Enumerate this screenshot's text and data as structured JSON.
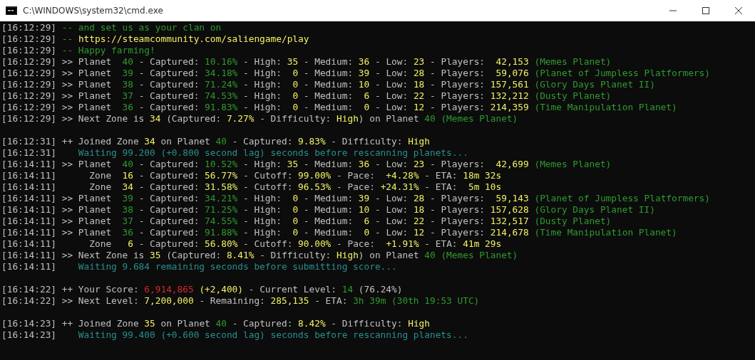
{
  "window": {
    "title": "C:\\WINDOWS\\system32\\cmd.exe"
  },
  "lines": [
    {
      "kind": "log",
      "time": "[16:12:29]",
      "segments": [
        {
          "text": " -- and set us as your clan on",
          "color": "#2f9a2f"
        }
      ]
    },
    {
      "kind": "log",
      "time": "[16:12:29]",
      "segments": [
        {
          "text": " -- ",
          "color": "#2f9a2f"
        },
        {
          "text": "https://steamcommunity.com/saliengame/play",
          "color": "#f2f266"
        }
      ]
    },
    {
      "kind": "log",
      "time": "[16:12:29]",
      "segments": [
        {
          "text": " -- Happy farming!",
          "color": "#2f9a2f"
        }
      ]
    },
    {
      "kind": "log",
      "time": "[16:12:29]",
      "segments": [
        {
          "text": " >> Planet  ",
          "color": "#c0c0c0"
        },
        {
          "text": "40",
          "color": "#2f9a2f"
        },
        {
          "text": " - Captured: ",
          "color": "#c0c0c0"
        },
        {
          "text": "10.16%",
          "color": "#2f9a2f"
        },
        {
          "text": " - High: ",
          "color": "#c0c0c0"
        },
        {
          "text": "35",
          "color": "#f2f266"
        },
        {
          "text": " - Medium: ",
          "color": "#c0c0c0"
        },
        {
          "text": "36",
          "color": "#f2f266"
        },
        {
          "text": " - Low: ",
          "color": "#c0c0c0"
        },
        {
          "text": "23",
          "color": "#f2f266"
        },
        {
          "text": " - Players:  ",
          "color": "#c0c0c0"
        },
        {
          "text": "42,153",
          "color": "#f2f266"
        },
        {
          "text": " (Memes Planet)",
          "color": "#2f9a2f"
        }
      ]
    },
    {
      "kind": "log",
      "time": "[16:12:29]",
      "segments": [
        {
          "text": " >> Planet  ",
          "color": "#c0c0c0"
        },
        {
          "text": "39",
          "color": "#2f9a2f"
        },
        {
          "text": " - Captured: ",
          "color": "#c0c0c0"
        },
        {
          "text": "34.18%",
          "color": "#2f9a2f"
        },
        {
          "text": " - High:  ",
          "color": "#c0c0c0"
        },
        {
          "text": "0",
          "color": "#f2f266"
        },
        {
          "text": " - Medium: ",
          "color": "#c0c0c0"
        },
        {
          "text": "39",
          "color": "#f2f266"
        },
        {
          "text": " - Low: ",
          "color": "#c0c0c0"
        },
        {
          "text": "28",
          "color": "#f2f266"
        },
        {
          "text": " - Players:  ",
          "color": "#c0c0c0"
        },
        {
          "text": "59,076",
          "color": "#f2f266"
        },
        {
          "text": " (Planet of Jumpless Platformers)",
          "color": "#2f9a2f"
        }
      ]
    },
    {
      "kind": "log",
      "time": "[16:12:29]",
      "segments": [
        {
          "text": " >> Planet  ",
          "color": "#c0c0c0"
        },
        {
          "text": "38",
          "color": "#2f9a2f"
        },
        {
          "text": " - Captured: ",
          "color": "#c0c0c0"
        },
        {
          "text": "71.24%",
          "color": "#2f9a2f"
        },
        {
          "text": " - High:  ",
          "color": "#c0c0c0"
        },
        {
          "text": "0",
          "color": "#f2f266"
        },
        {
          "text": " - Medium: ",
          "color": "#c0c0c0"
        },
        {
          "text": "10",
          "color": "#f2f266"
        },
        {
          "text": " - Low: ",
          "color": "#c0c0c0"
        },
        {
          "text": "18",
          "color": "#f2f266"
        },
        {
          "text": " - Players: ",
          "color": "#c0c0c0"
        },
        {
          "text": "157,561",
          "color": "#f2f266"
        },
        {
          "text": " (Glory Days Planet II)",
          "color": "#2f9a2f"
        }
      ]
    },
    {
      "kind": "log",
      "time": "[16:12:29]",
      "segments": [
        {
          "text": " >> Planet  ",
          "color": "#c0c0c0"
        },
        {
          "text": "37",
          "color": "#2f9a2f"
        },
        {
          "text": " - Captured: ",
          "color": "#c0c0c0"
        },
        {
          "text": "74.53%",
          "color": "#2f9a2f"
        },
        {
          "text": " - High:  ",
          "color": "#c0c0c0"
        },
        {
          "text": "0",
          "color": "#f2f266"
        },
        {
          "text": " - Medium:  ",
          "color": "#c0c0c0"
        },
        {
          "text": "6",
          "color": "#f2f266"
        },
        {
          "text": " - Low: ",
          "color": "#c0c0c0"
        },
        {
          "text": "22",
          "color": "#f2f266"
        },
        {
          "text": " - Players: ",
          "color": "#c0c0c0"
        },
        {
          "text": "132,212",
          "color": "#f2f266"
        },
        {
          "text": " (Dusty Planet)",
          "color": "#2f9a2f"
        }
      ]
    },
    {
      "kind": "log",
      "time": "[16:12:29]",
      "segments": [
        {
          "text": " >> Planet  ",
          "color": "#c0c0c0"
        },
        {
          "text": "36",
          "color": "#2f9a2f"
        },
        {
          "text": " - Captured: ",
          "color": "#c0c0c0"
        },
        {
          "text": "91.83%",
          "color": "#2f9a2f"
        },
        {
          "text": " - High:  ",
          "color": "#c0c0c0"
        },
        {
          "text": "0",
          "color": "#f2f266"
        },
        {
          "text": " - Medium:  ",
          "color": "#c0c0c0"
        },
        {
          "text": "0",
          "color": "#f2f266"
        },
        {
          "text": " - Low: ",
          "color": "#c0c0c0"
        },
        {
          "text": "12",
          "color": "#f2f266"
        },
        {
          "text": " - Players: ",
          "color": "#c0c0c0"
        },
        {
          "text": "214,359",
          "color": "#f2f266"
        },
        {
          "text": " (Time Manipulation Planet)",
          "color": "#2f9a2f"
        }
      ]
    },
    {
      "kind": "log",
      "time": "[16:12:29]",
      "segments": [
        {
          "text": " >> Next Zone is ",
          "color": "#c0c0c0"
        },
        {
          "text": "34",
          "color": "#f2f266"
        },
        {
          "text": " (Captured: ",
          "color": "#c0c0c0"
        },
        {
          "text": "7.27%",
          "color": "#f2f266"
        },
        {
          "text": " - Difficulty: ",
          "color": "#c0c0c0"
        },
        {
          "text": "High",
          "color": "#f2f266"
        },
        {
          "text": ") on Planet ",
          "color": "#c0c0c0"
        },
        {
          "text": "40 (Memes Planet)",
          "color": "#2f9a2f"
        }
      ]
    },
    {
      "kind": "blank"
    },
    {
      "kind": "log",
      "time": "[16:12:31]",
      "segments": [
        {
          "text": " ++ Joined Zone ",
          "color": "#c0c0c0"
        },
        {
          "text": "34",
          "color": "#f2f266"
        },
        {
          "text": " on Planet ",
          "color": "#c0c0c0"
        },
        {
          "text": "40",
          "color": "#2f9a2f"
        },
        {
          "text": " - Captured: ",
          "color": "#c0c0c0"
        },
        {
          "text": "9.83%",
          "color": "#f2f266"
        },
        {
          "text": " - Difficulty: ",
          "color": "#c0c0c0"
        },
        {
          "text": "High",
          "color": "#f2f266"
        }
      ]
    },
    {
      "kind": "log",
      "time": "[16:12:31]",
      "segments": [
        {
          "text": "    Waiting 99.200 (+0.800 second lag) seconds before rescanning planets...",
          "color": "#2a8e8e"
        }
      ]
    },
    {
      "kind": "log",
      "time": "[16:14:11]",
      "segments": [
        {
          "text": " >> Planet  ",
          "color": "#c0c0c0"
        },
        {
          "text": "40",
          "color": "#2f9a2f"
        },
        {
          "text": " - Captured: ",
          "color": "#c0c0c0"
        },
        {
          "text": "10.52%",
          "color": "#2f9a2f"
        },
        {
          "text": " - High: ",
          "color": "#c0c0c0"
        },
        {
          "text": "35",
          "color": "#f2f266"
        },
        {
          "text": " - Medium: ",
          "color": "#c0c0c0"
        },
        {
          "text": "36",
          "color": "#f2f266"
        },
        {
          "text": " - Low: ",
          "color": "#c0c0c0"
        },
        {
          "text": "23",
          "color": "#f2f266"
        },
        {
          "text": " - Players:  ",
          "color": "#c0c0c0"
        },
        {
          "text": "42,699",
          "color": "#f2f266"
        },
        {
          "text": " (Memes Planet)",
          "color": "#2f9a2f"
        }
      ]
    },
    {
      "kind": "log",
      "time": "[16:14:11]",
      "segments": [
        {
          "text": "      Zone  ",
          "color": "#c0c0c0"
        },
        {
          "text": "16",
          "color": "#f2f266"
        },
        {
          "text": " - Captured: ",
          "color": "#c0c0c0"
        },
        {
          "text": "56.77%",
          "color": "#f2f266"
        },
        {
          "text": " - Cutoff: ",
          "color": "#c0c0c0"
        },
        {
          "text": "99.00%",
          "color": "#f2f266"
        },
        {
          "text": " - Pace:  ",
          "color": "#c0c0c0"
        },
        {
          "text": "+4.28%",
          "color": "#f2f266"
        },
        {
          "text": " - ETA: ",
          "color": "#c0c0c0"
        },
        {
          "text": "18m 32s",
          "color": "#f2f266"
        }
      ]
    },
    {
      "kind": "log",
      "time": "[16:14:11]",
      "segments": [
        {
          "text": "      Zone  ",
          "color": "#c0c0c0"
        },
        {
          "text": "34",
          "color": "#f2f266"
        },
        {
          "text": " - Captured: ",
          "color": "#c0c0c0"
        },
        {
          "text": "31.58%",
          "color": "#f2f266"
        },
        {
          "text": " - Cutoff: ",
          "color": "#c0c0c0"
        },
        {
          "text": "96.53%",
          "color": "#f2f266"
        },
        {
          "text": " - Pace: ",
          "color": "#c0c0c0"
        },
        {
          "text": "+24.31%",
          "color": "#f2f266"
        },
        {
          "text": " - ETA:  ",
          "color": "#c0c0c0"
        },
        {
          "text": "5m 10s",
          "color": "#f2f266"
        }
      ]
    },
    {
      "kind": "log",
      "time": "[16:14:11]",
      "segments": [
        {
          "text": " >> Planet  ",
          "color": "#c0c0c0"
        },
        {
          "text": "39",
          "color": "#2f9a2f"
        },
        {
          "text": " - Captured: ",
          "color": "#c0c0c0"
        },
        {
          "text": "34.21%",
          "color": "#2f9a2f"
        },
        {
          "text": " - High:  ",
          "color": "#c0c0c0"
        },
        {
          "text": "0",
          "color": "#f2f266"
        },
        {
          "text": " - Medium: ",
          "color": "#c0c0c0"
        },
        {
          "text": "39",
          "color": "#f2f266"
        },
        {
          "text": " - Low: ",
          "color": "#c0c0c0"
        },
        {
          "text": "28",
          "color": "#f2f266"
        },
        {
          "text": " - Players:  ",
          "color": "#c0c0c0"
        },
        {
          "text": "59,143",
          "color": "#f2f266"
        },
        {
          "text": " (Planet of Jumpless Platformers)",
          "color": "#2f9a2f"
        }
      ]
    },
    {
      "kind": "log",
      "time": "[16:14:11]",
      "segments": [
        {
          "text": " >> Planet  ",
          "color": "#c0c0c0"
        },
        {
          "text": "38",
          "color": "#2f9a2f"
        },
        {
          "text": " - Captured: ",
          "color": "#c0c0c0"
        },
        {
          "text": "71.25%",
          "color": "#2f9a2f"
        },
        {
          "text": " - High:  ",
          "color": "#c0c0c0"
        },
        {
          "text": "0",
          "color": "#f2f266"
        },
        {
          "text": " - Medium: ",
          "color": "#c0c0c0"
        },
        {
          "text": "10",
          "color": "#f2f266"
        },
        {
          "text": " - Low: ",
          "color": "#c0c0c0"
        },
        {
          "text": "18",
          "color": "#f2f266"
        },
        {
          "text": " - Players: ",
          "color": "#c0c0c0"
        },
        {
          "text": "157,628",
          "color": "#f2f266"
        },
        {
          "text": " (Glory Days Planet II)",
          "color": "#2f9a2f"
        }
      ]
    },
    {
      "kind": "log",
      "time": "[16:14:11]",
      "segments": [
        {
          "text": " >> Planet  ",
          "color": "#c0c0c0"
        },
        {
          "text": "37",
          "color": "#2f9a2f"
        },
        {
          "text": " - Captured: ",
          "color": "#c0c0c0"
        },
        {
          "text": "74.55%",
          "color": "#2f9a2f"
        },
        {
          "text": " - High:  ",
          "color": "#c0c0c0"
        },
        {
          "text": "0",
          "color": "#f2f266"
        },
        {
          "text": " - Medium:  ",
          "color": "#c0c0c0"
        },
        {
          "text": "6",
          "color": "#f2f266"
        },
        {
          "text": " - Low: ",
          "color": "#c0c0c0"
        },
        {
          "text": "22",
          "color": "#f2f266"
        },
        {
          "text": " - Players: ",
          "color": "#c0c0c0"
        },
        {
          "text": "132,517",
          "color": "#f2f266"
        },
        {
          "text": " (Dusty Planet)",
          "color": "#2f9a2f"
        }
      ]
    },
    {
      "kind": "log",
      "time": "[16:14:11]",
      "segments": [
        {
          "text": " >> Planet  ",
          "color": "#c0c0c0"
        },
        {
          "text": "36",
          "color": "#2f9a2f"
        },
        {
          "text": " - Captured: ",
          "color": "#c0c0c0"
        },
        {
          "text": "91.88%",
          "color": "#2f9a2f"
        },
        {
          "text": " - High:  ",
          "color": "#c0c0c0"
        },
        {
          "text": "0",
          "color": "#f2f266"
        },
        {
          "text": " - Medium:  ",
          "color": "#c0c0c0"
        },
        {
          "text": "0",
          "color": "#f2f266"
        },
        {
          "text": " - Low: ",
          "color": "#c0c0c0"
        },
        {
          "text": "12",
          "color": "#f2f266"
        },
        {
          "text": " - Players: ",
          "color": "#c0c0c0"
        },
        {
          "text": "214,678",
          "color": "#f2f266"
        },
        {
          "text": " (Time Manipulation Planet)",
          "color": "#2f9a2f"
        }
      ]
    },
    {
      "kind": "log",
      "time": "[16:14:11]",
      "segments": [
        {
          "text": "      Zone   ",
          "color": "#c0c0c0"
        },
        {
          "text": "6",
          "color": "#f2f266"
        },
        {
          "text": " - Captured: ",
          "color": "#c0c0c0"
        },
        {
          "text": "56.80%",
          "color": "#f2f266"
        },
        {
          "text": " - Cutoff: ",
          "color": "#c0c0c0"
        },
        {
          "text": "90.00%",
          "color": "#f2f266"
        },
        {
          "text": " - Pace:  ",
          "color": "#c0c0c0"
        },
        {
          "text": "+1.91%",
          "color": "#f2f266"
        },
        {
          "text": " - ETA: ",
          "color": "#c0c0c0"
        },
        {
          "text": "41m 29s",
          "color": "#f2f266"
        }
      ]
    },
    {
      "kind": "log",
      "time": "[16:14:11]",
      "segments": [
        {
          "text": " >> Next Zone is ",
          "color": "#c0c0c0"
        },
        {
          "text": "35",
          "color": "#f2f266"
        },
        {
          "text": " (Captured: ",
          "color": "#c0c0c0"
        },
        {
          "text": "8.41%",
          "color": "#f2f266"
        },
        {
          "text": " - Difficulty: ",
          "color": "#c0c0c0"
        },
        {
          "text": "High",
          "color": "#f2f266"
        },
        {
          "text": ") on Planet ",
          "color": "#c0c0c0"
        },
        {
          "text": "40 (Memes Planet)",
          "color": "#2f9a2f"
        }
      ]
    },
    {
      "kind": "log",
      "time": "[16:14:11]",
      "segments": [
        {
          "text": "    Waiting 9.684 remaining seconds before submitting score...",
          "color": "#2a8e8e"
        }
      ]
    },
    {
      "kind": "blank"
    },
    {
      "kind": "log",
      "time": "[16:14:22]",
      "segments": [
        {
          "text": " ++ Your Score: ",
          "color": "#c0c0c0"
        },
        {
          "text": "6,914,865",
          "color": "#d42a2a"
        },
        {
          "text": " (+2,400)",
          "color": "#f2f266"
        },
        {
          "text": " - Current Level: ",
          "color": "#c0c0c0"
        },
        {
          "text": "14",
          "color": "#2f9a2f"
        },
        {
          "text": " (76.24%)",
          "color": "#c0c0c0"
        }
      ]
    },
    {
      "kind": "log",
      "time": "[16:14:22]",
      "segments": [
        {
          "text": " >> Next Level: ",
          "color": "#c0c0c0"
        },
        {
          "text": "7,200,000",
          "color": "#f2f266"
        },
        {
          "text": " - Remaining: ",
          "color": "#c0c0c0"
        },
        {
          "text": "285,135",
          "color": "#f2f266"
        },
        {
          "text": " - ETA: ",
          "color": "#c0c0c0"
        },
        {
          "text": "3h 39m (30th 19:53 UTC)",
          "color": "#2f9a2f"
        }
      ]
    },
    {
      "kind": "blank"
    },
    {
      "kind": "log",
      "time": "[16:14:23]",
      "segments": [
        {
          "text": " ++ Joined Zone ",
          "color": "#c0c0c0"
        },
        {
          "text": "35",
          "color": "#f2f266"
        },
        {
          "text": " on Planet ",
          "color": "#c0c0c0"
        },
        {
          "text": "40",
          "color": "#2f9a2f"
        },
        {
          "text": " - Captured: ",
          "color": "#c0c0c0"
        },
        {
          "text": "8.42%",
          "color": "#f2f266"
        },
        {
          "text": " - Difficulty: ",
          "color": "#c0c0c0"
        },
        {
          "text": "High",
          "color": "#f2f266"
        }
      ]
    },
    {
      "kind": "log",
      "time": "[16:14:23]",
      "segments": [
        {
          "text": "    Waiting 99.400 (+0.600 second lag) seconds before rescanning planets...",
          "color": "#2a8e8e"
        }
      ]
    }
  ]
}
